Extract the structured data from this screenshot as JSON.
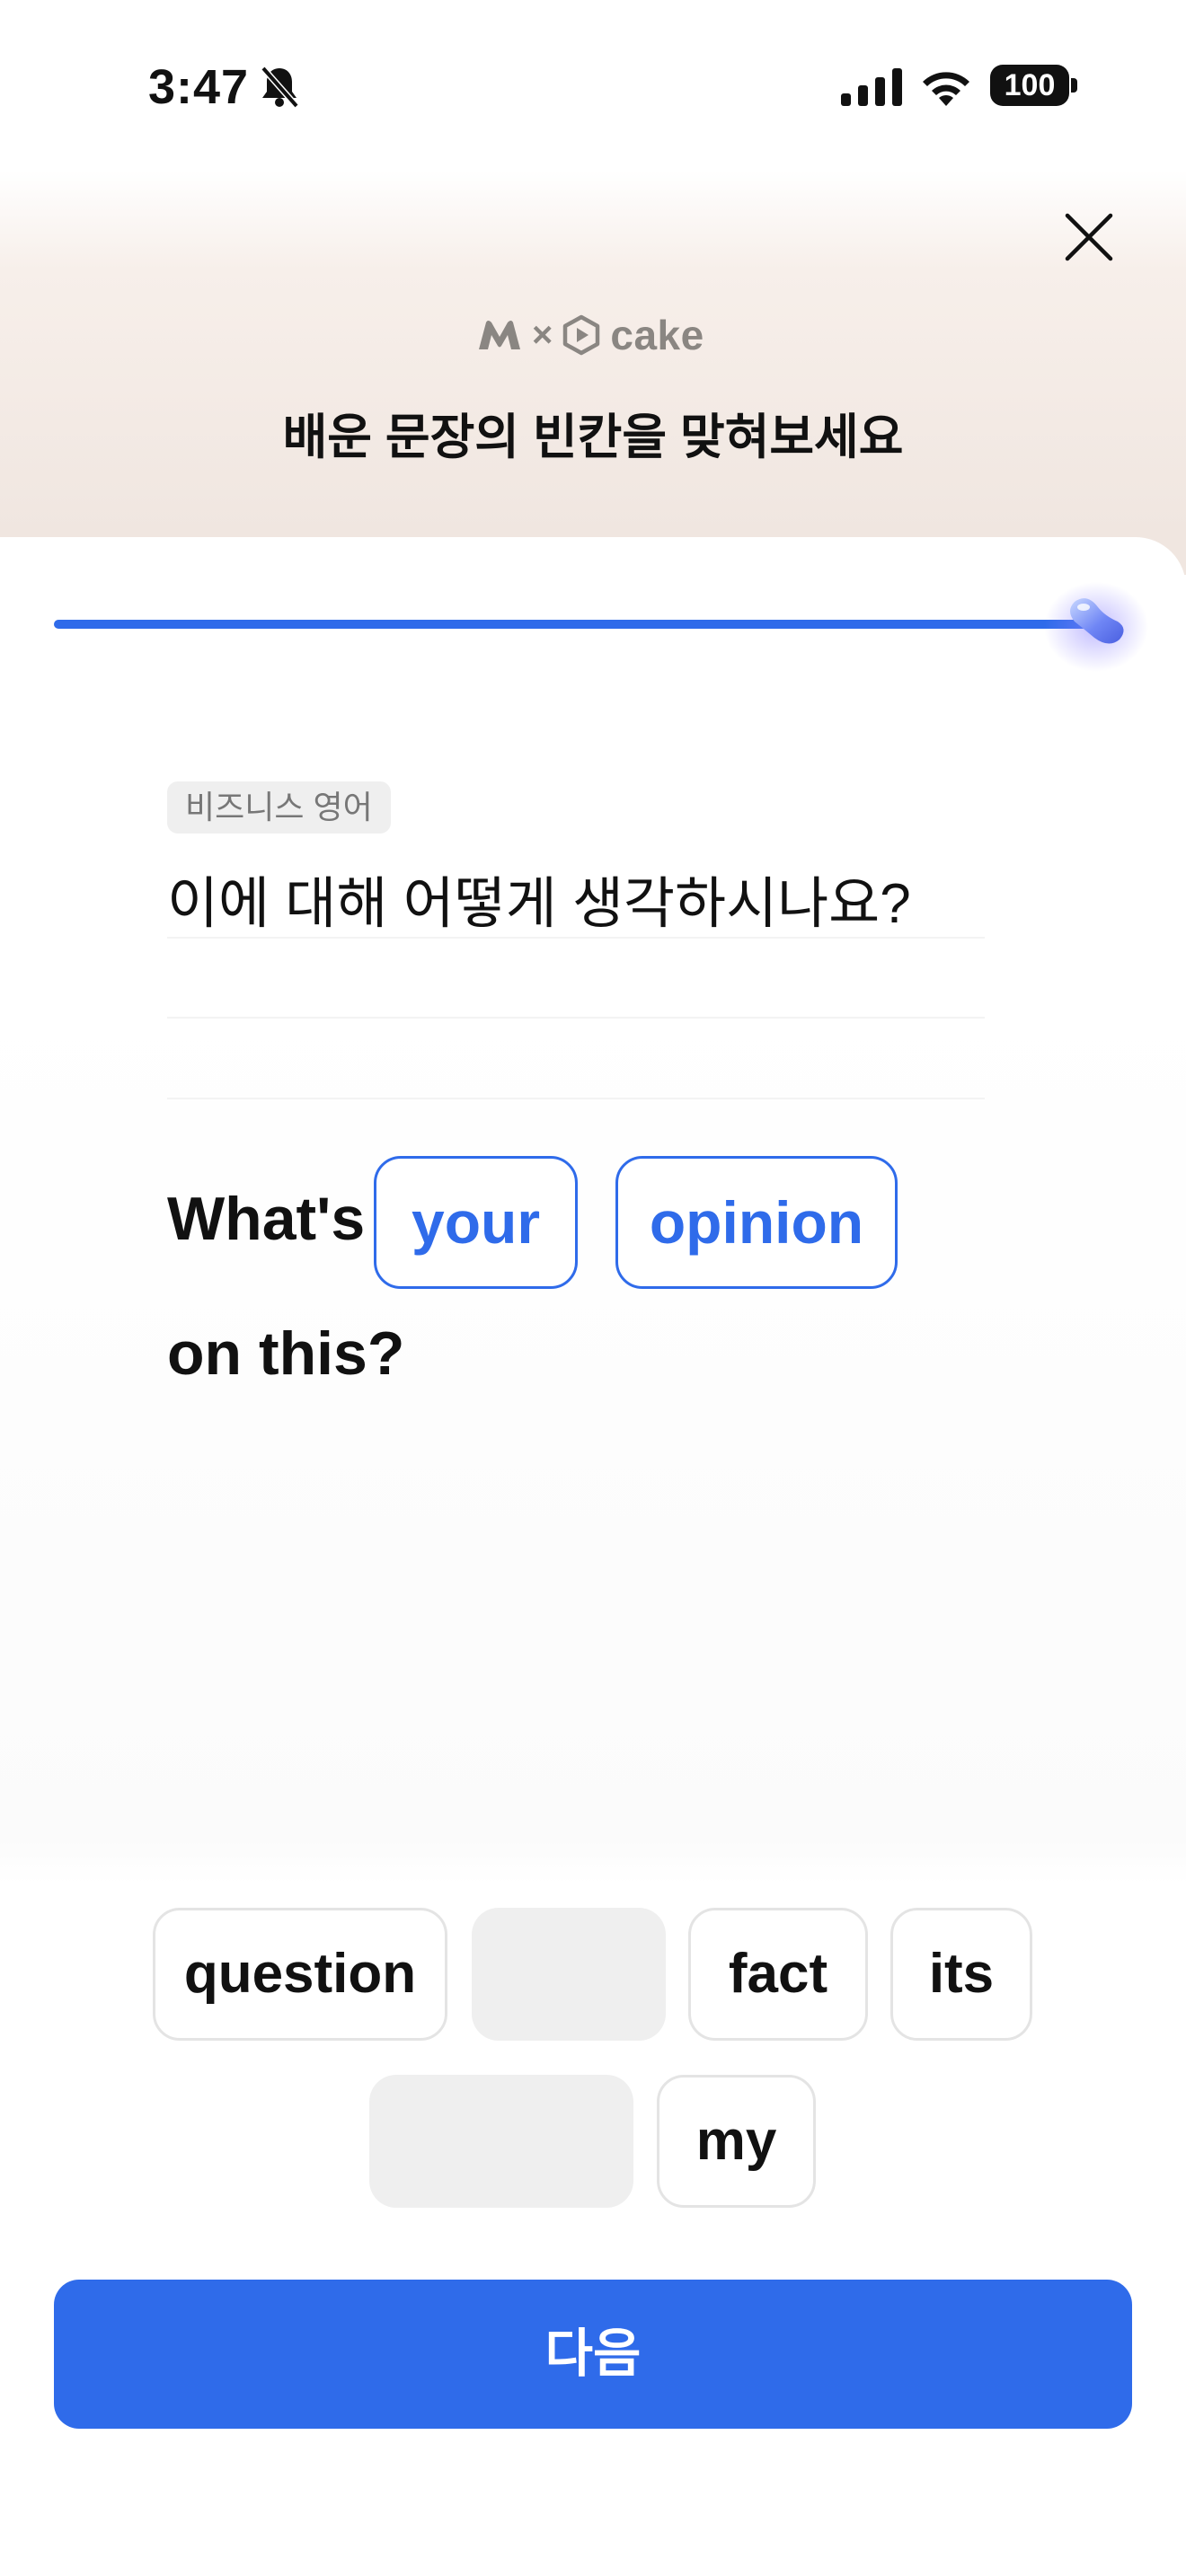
{
  "status_bar": {
    "time": "3:47",
    "battery": "100"
  },
  "header": {
    "brand_separator": "×",
    "brand_name": "cake",
    "title": "배운 문장의 빈칸을 맞혀보세요"
  },
  "progress": {
    "fraction": 1.0
  },
  "question": {
    "category": "비즈니스 영어",
    "korean": "이에 대해 어떻게 생각하시나요?",
    "sentence_start": "What's",
    "filled_answers": [
      "your",
      "opinion"
    ],
    "sentence_end": "on this?"
  },
  "word_bank": {
    "row1": [
      "question",
      "",
      "fact",
      "its"
    ],
    "row2": [
      "",
      "my"
    ]
  },
  "next_button": {
    "label": "다음"
  },
  "colors": {
    "accent": "#2f6bea",
    "chip_border": "#e4e4e4",
    "slot": "#efefef"
  }
}
